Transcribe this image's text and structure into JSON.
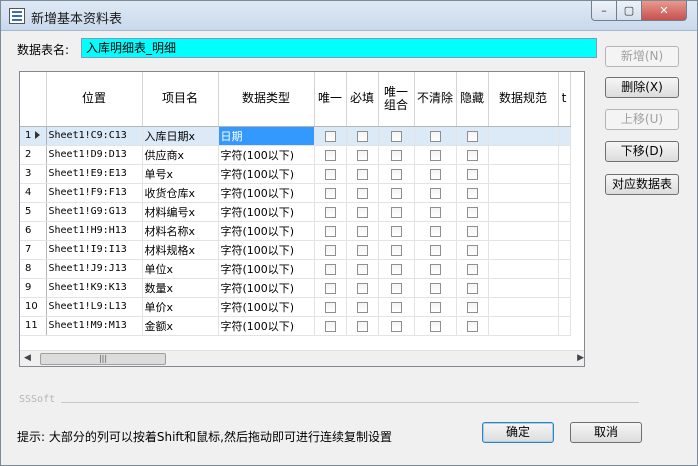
{
  "window": {
    "title": "新增基本资料表",
    "close_glyph": "✕",
    "maximize_glyph": "▢",
    "minimize_glyph": "–"
  },
  "table_name": {
    "label": "数据表名:",
    "value": "入库明细表_明细",
    "highlight_color": "#00ffff"
  },
  "grid": {
    "columns": [
      "位置",
      "项目名",
      "数据类型",
      "唯一",
      "必填",
      "唯一\n组合",
      "不清除",
      "隐藏",
      "数据规范",
      "t"
    ],
    "rows": [
      {
        "num": "1",
        "pos": "Sheet1!C9:C13",
        "name": "入库日期x",
        "type": "日期",
        "selected": true
      },
      {
        "num": "2",
        "pos": "Sheet1!D9:D13",
        "name": "供应商x",
        "type": "字符(100以下)"
      },
      {
        "num": "3",
        "pos": "Sheet1!E9:E13",
        "name": "单号x",
        "type": "字符(100以下)"
      },
      {
        "num": "4",
        "pos": "Sheet1!F9:F13",
        "name": "收货仓库x",
        "type": "字符(100以下)"
      },
      {
        "num": "5",
        "pos": "Sheet1!G9:G13",
        "name": "材料编号x",
        "type": "字符(100以下)"
      },
      {
        "num": "6",
        "pos": "Sheet1!H9:H13",
        "name": "材料名称x",
        "type": "字符(100以下)"
      },
      {
        "num": "7",
        "pos": "Sheet1!I9:I13",
        "name": "材料规格x",
        "type": "字符(100以下)"
      },
      {
        "num": "8",
        "pos": "Sheet1!J9:J13",
        "name": "单位x",
        "type": "字符(100以下)"
      },
      {
        "num": "9",
        "pos": "Sheet1!K9:K13",
        "name": "数量x",
        "type": "字符(100以下)"
      },
      {
        "num": "10",
        "pos": "Sheet1!L9:L13",
        "name": "单价x",
        "type": "字符(100以下)"
      },
      {
        "num": "11",
        "pos": "Sheet1!M9:M13",
        "name": "金额x",
        "type": "字符(100以下)"
      }
    ],
    "selection_color": "#3399ff"
  },
  "side_buttons": {
    "add": "新增(N)",
    "delete": "删除(X)",
    "move_up": "上移(U)",
    "move_down": "下移(D)",
    "map_table": "对应数据表"
  },
  "footer": {
    "brand": "SSSoft",
    "hint": "提示: 大部分的列可以按着Shift和鼠标,然后拖动即可进行连续复制设置",
    "ok": "确定",
    "cancel": "取消"
  }
}
